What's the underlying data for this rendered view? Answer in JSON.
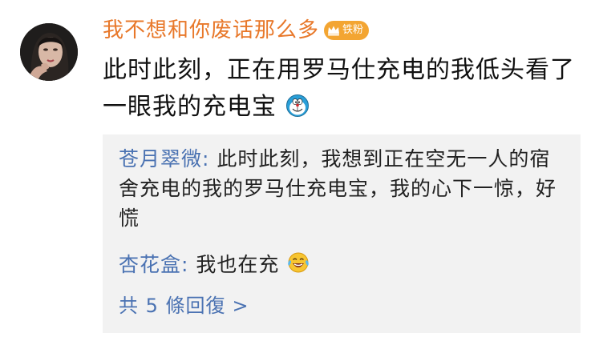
{
  "post": {
    "username": "我不想和你废话那么多",
    "badge_label": "铁粉",
    "badge_icon": "crown-icon",
    "text": "此时此刻，正在用罗马仕充电的我低头看了一眼我的充电宝",
    "emoji": "doraemon-emoji",
    "accent_color": "#e8782a"
  },
  "comments": [
    {
      "author": "苍月翠微",
      "separator": ": ",
      "text": "此时此刻，我想到正在空无一人的宿舍充电的我的罗马仕充电宝，我的心下一惊，好慌"
    },
    {
      "author": "杏花盒",
      "separator": ": ",
      "text": "我也在充",
      "emoji": "laughing-tears-emoji"
    }
  ],
  "more_replies": {
    "label": "共 5 條回復",
    "chevron": ">"
  },
  "colors": {
    "username": "#e8782a",
    "link": "#4a72b2",
    "comment_bg": "#f2f2f2",
    "badge_bg": "#f3a532"
  }
}
